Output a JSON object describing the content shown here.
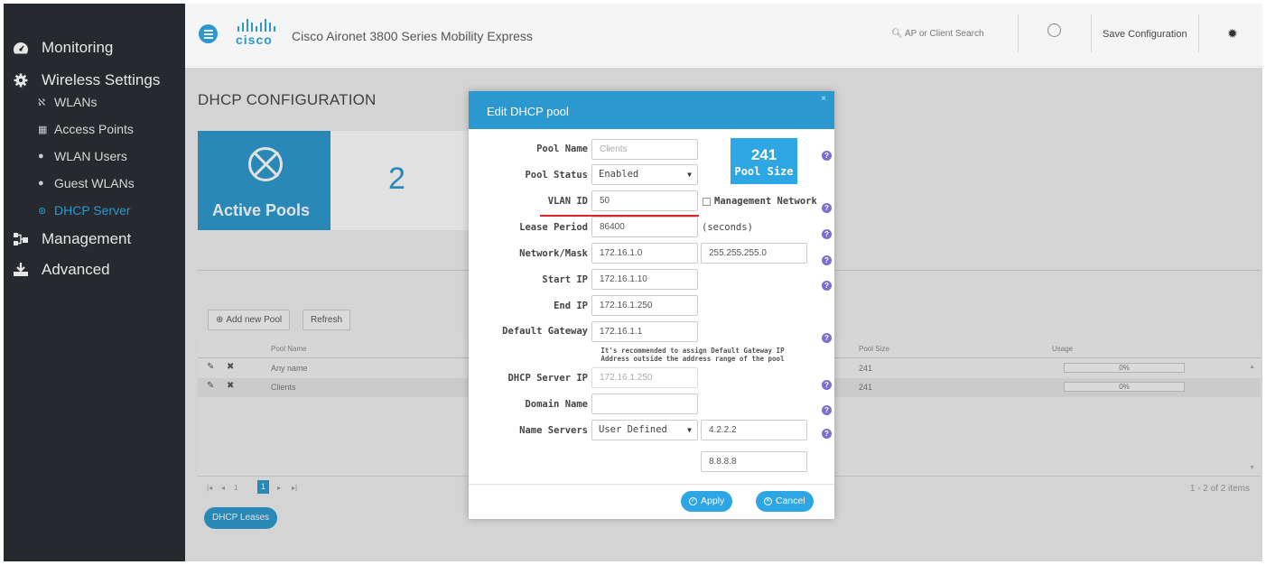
{
  "sidebar": {
    "monitoring": "Monitoring",
    "wireless_settings": "Wireless Settings",
    "wlans": "WLANs",
    "access_points": "Access Points",
    "wlan_users": "WLAN Users",
    "guest_wlans": "Guest WLANs",
    "dhcp_server": "DHCP Server",
    "management": "Management",
    "advanced": "Advanced"
  },
  "header": {
    "logo_text": "cisco",
    "title": "Cisco Aironet 3800 Series Mobility Express",
    "search_placeholder": "AP or Client Search",
    "save_config": "Save Configuration"
  },
  "page": {
    "title": "DHCP CONFIGURATION",
    "active_pools_label": "Active Pools",
    "active_pools_count": "2",
    "add_new_pool": "Add new Pool",
    "refresh": "Refresh",
    "columns": {
      "pool_name": "Pool Name",
      "pool_size": "Pool Size",
      "usage": "Usage"
    },
    "rows": [
      {
        "name": "Any name",
        "size": "241",
        "usage": "0%"
      },
      {
        "name": "Clients",
        "size": "241",
        "usage": "0%"
      }
    ],
    "pager_page": "1",
    "items_count": "1 - 2 of 2 items",
    "dhcp_leases": "DHCP Leases"
  },
  "modal": {
    "title": "Edit DHCP pool",
    "close": "×",
    "pool_size_value": "241",
    "pool_size_label": "Pool Size",
    "fields": {
      "pool_name_label": "Pool Name",
      "pool_name_value": "Clients",
      "pool_status_label": "Pool Status",
      "pool_status_value": "Enabled",
      "vlan_id_label": "VLAN ID",
      "vlan_id_value": "50",
      "management_network": "Management Network",
      "lease_period_label": "Lease Period",
      "lease_period_value": "86400",
      "lease_period_unit": "(seconds)",
      "network_mask_label": "Network/Mask",
      "network_value": "172.16.1.0",
      "mask_value": "255.255.255.0",
      "start_ip_label": "Start IP",
      "start_ip_value": "172.16.1.10",
      "end_ip_label": "End IP",
      "end_ip_value": "172.16.1.250",
      "default_gateway_label": "Default Gateway",
      "default_gateway_value": "172.16.1.1",
      "gateway_note": "It's recommended to assign Default Gateway IP Address outside the address range of the pool",
      "dhcp_server_ip_label": "DHCP Server IP",
      "dhcp_server_ip_value": "172.16.1.250",
      "domain_name_label": "Domain Name",
      "domain_name_value": "",
      "name_servers_label": "Name Servers",
      "name_servers_mode": "User Defined",
      "name_server_1": "4.2.2.2",
      "name_server_2": "8.8.8.8"
    },
    "apply": "Apply",
    "cancel": "Cancel"
  },
  "colors": {
    "accent": "#2b98cf",
    "sidebar_bg": "#262a2f",
    "help_icon": "#7d6fcf",
    "highlight_line": "#d9232d"
  }
}
